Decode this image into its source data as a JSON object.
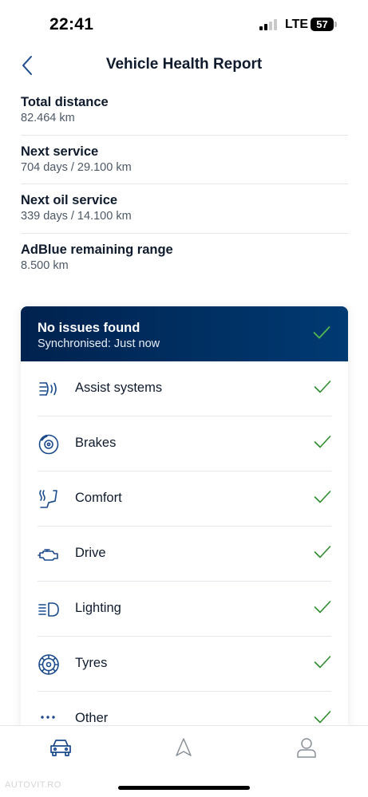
{
  "status_bar": {
    "time": "22:41",
    "network": "LTE",
    "battery": "57"
  },
  "header": {
    "title": "Vehicle Health Report",
    "back_icon": "chevron-left-icon"
  },
  "info": [
    {
      "label": "Total distance",
      "value": "82.464 km"
    },
    {
      "label": "Next service",
      "value": "704 days / 29.100 km"
    },
    {
      "label": "Next oil service",
      "value": "339 days / 14.100 km"
    },
    {
      "label": "AdBlue remaining range",
      "value": "8.500 km"
    }
  ],
  "health_card": {
    "title": "No issues found",
    "subtitle": "Synchronised: Just now",
    "items": [
      {
        "label": "Assist systems",
        "icon": "assist-systems-icon",
        "status": "ok"
      },
      {
        "label": "Brakes",
        "icon": "brake-disc-icon",
        "status": "ok"
      },
      {
        "label": "Comfort",
        "icon": "heated-seat-icon",
        "status": "ok"
      },
      {
        "label": "Drive",
        "icon": "engine-icon",
        "status": "ok"
      },
      {
        "label": "Lighting",
        "icon": "headlight-icon",
        "status": "ok"
      },
      {
        "label": "Tyres",
        "icon": "tyre-icon",
        "status": "ok"
      },
      {
        "label": "Other",
        "icon": "more-dots-icon",
        "status": "ok"
      }
    ]
  },
  "tab_bar": {
    "tabs": [
      {
        "icon": "car-icon",
        "active": true
      },
      {
        "icon": "navigation-arrow-icon",
        "active": false
      },
      {
        "icon": "profile-icon",
        "active": false
      }
    ]
  },
  "watermark": "AUTOVIT.RO",
  "colors": {
    "brand_dark": "#00224f",
    "accent_blue": "#1a4a8c",
    "check_green": "#2e8b2e",
    "text_primary": "#0f1b2d",
    "text_secondary": "#4d5866"
  }
}
